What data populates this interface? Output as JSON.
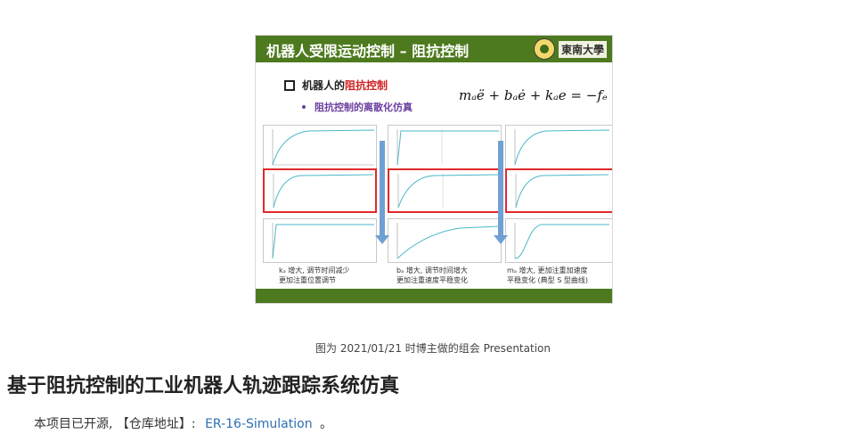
{
  "slide": {
    "title": "机器人受限运动控制 – 阻抗控制",
    "logo_text": "東南大學",
    "bullet1_prefix": "机器人的",
    "bullet1_highlight": "阻抗控制",
    "bullet2": "阻抗控制的离散化仿真",
    "equation": "mₐë + bₐė + kₐe = −fₑ",
    "notes": [
      {
        "line1": "kₐ 增大, 调节时间减少",
        "line2": "更加注重位置调节"
      },
      {
        "line1": "bₐ 增大, 调节时间增大",
        "line2": "更加注重速度平稳变化"
      },
      {
        "line1": "mₐ 增大, 更加注重加速度",
        "line2": "平稳变化 (典型 S 型曲线)"
      }
    ],
    "colors": {
      "header": "#4e7a1f",
      "highlight": "#d32020",
      "bullet2": "#6b3fa0",
      "arrow": "#6fa0d3",
      "red_box": "#e02a2a"
    }
  },
  "caption": "图为 2021/01/21 时博主做的组会 Presentation",
  "heading": "基于阻抗控制的工业机器人轨迹跟踪系统仿真",
  "paragraph": {
    "prefix": "本项目已开源, 【仓库地址】:",
    "link": "ER-16-Simulation",
    "suffix": "。"
  }
}
